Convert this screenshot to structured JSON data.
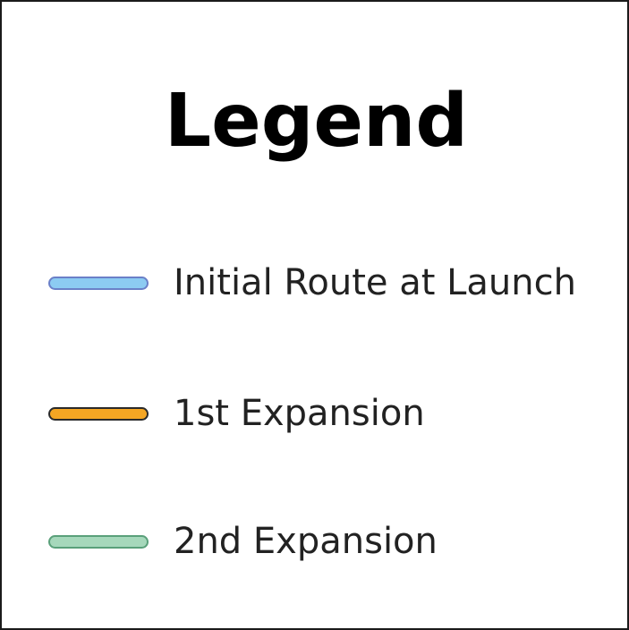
{
  "legend": {
    "title": "Legend",
    "items": [
      {
        "label": "Initial Route at Launch",
        "fill": "#8ccbf2",
        "stroke": "#6a80c8"
      },
      {
        "label": "1st Expansion",
        "fill": "#f5a623",
        "stroke": "#2a2a2a"
      },
      {
        "label": "2nd Expansion",
        "fill": "#a6d8bb",
        "stroke": "#5aa07a"
      }
    ]
  }
}
